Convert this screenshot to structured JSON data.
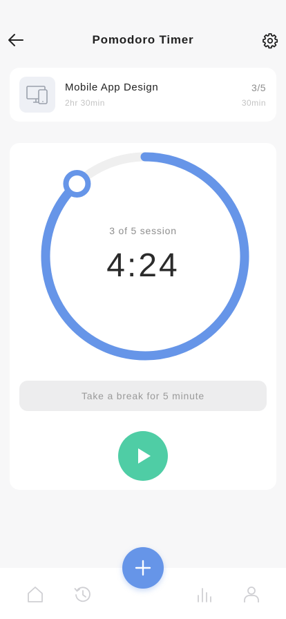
{
  "header": {
    "title": "Pomodoro Timer",
    "back_icon": "arrow-left-icon",
    "settings_icon": "gear-icon"
  },
  "task": {
    "name": "Mobile App Design",
    "duration": "2hr 30min",
    "sessions": "3/5",
    "session_duration": "30min",
    "icon": "devices-icon"
  },
  "timer": {
    "session_label": "3 of 5 session",
    "time": "4:24",
    "progress": 0.88,
    "break_message": "Take a break for 5 minute",
    "play_icon": "play-icon"
  },
  "nav": {
    "items": [
      "home-icon",
      "history-icon",
      "stats-icon",
      "profile-icon"
    ],
    "fab_icon": "plus-icon"
  },
  "colors": {
    "accent": "#6695E8",
    "track": "#EFEFEF",
    "play": "#4FCDA5",
    "background": "#F7F7F8"
  }
}
